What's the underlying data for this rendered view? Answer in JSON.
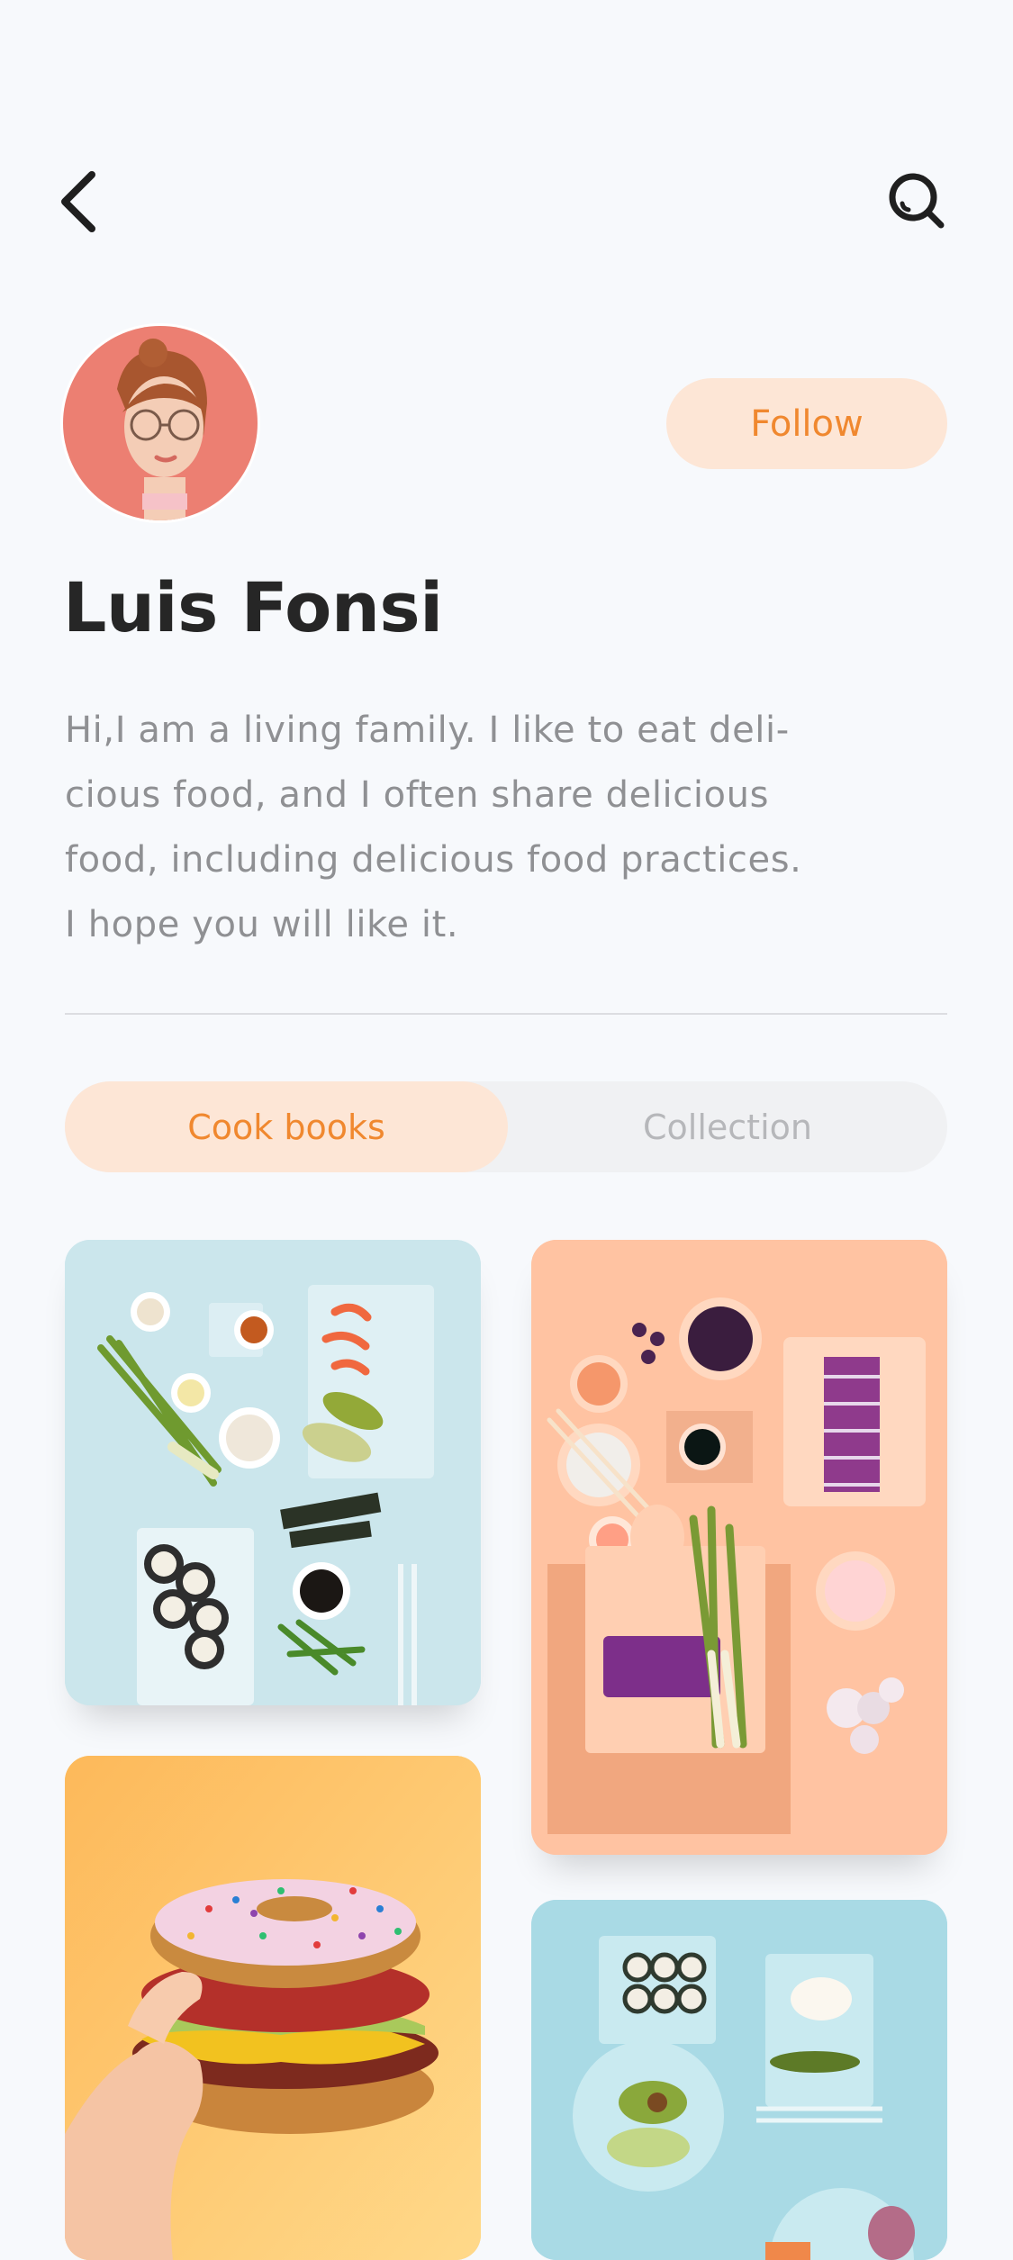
{
  "nav": {
    "back_icon": "chevron-left-icon",
    "search_icon": "search-icon"
  },
  "profile": {
    "name": "Luis Fonsi",
    "follow_label": "Follow",
    "bio_lines": [
      "Hi,I am a living family. I like to eat deli-",
      "cious food, and I often share delicious",
      "food, including delicious food practices.",
      "I hope you will like it."
    ]
  },
  "tabs": [
    {
      "label": "Cook books",
      "active": true
    },
    {
      "label": "Collection",
      "active": false
    }
  ],
  "colors": {
    "accent": "#f0882f",
    "accent_bg": "#fde6d6",
    "background": "#f7f9fc",
    "text_dark": "#262626",
    "text_muted": "#8f9093"
  }
}
